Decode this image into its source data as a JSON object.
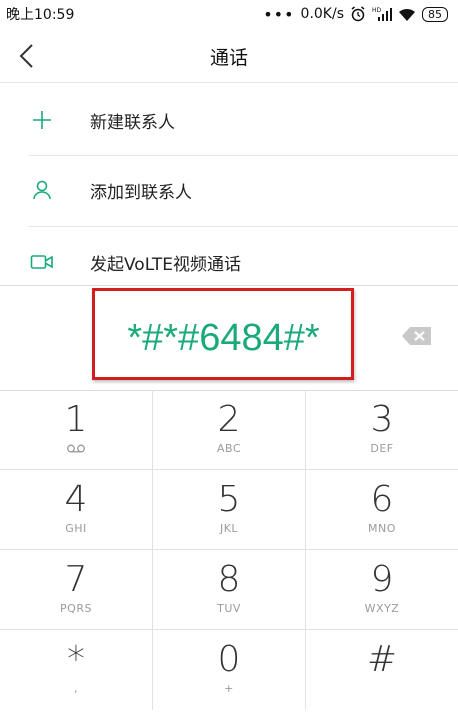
{
  "status_bar": {
    "time": "晚上10:59",
    "dots": "•••",
    "network_speed": "0.0K/s",
    "battery": "85"
  },
  "header": {
    "title": "通话"
  },
  "actions": [
    {
      "label": "新建联系人",
      "icon": "plus-icon"
    },
    {
      "label": "添加到联系人",
      "icon": "person-icon"
    },
    {
      "label": "发起VoLTE视频通话",
      "icon": "video-camera-icon"
    }
  ],
  "dialed_number": "*#*#6484#*",
  "keypad": [
    {
      "digit": "1",
      "letters": ""
    },
    {
      "digit": "2",
      "letters": "ABC"
    },
    {
      "digit": "3",
      "letters": "DEF"
    },
    {
      "digit": "4",
      "letters": "GHI"
    },
    {
      "digit": "5",
      "letters": "JKL"
    },
    {
      "digit": "6",
      "letters": "MNO"
    },
    {
      "digit": "7",
      "letters": "PQRS"
    },
    {
      "digit": "8",
      "letters": "TUV"
    },
    {
      "digit": "9",
      "letters": "WXYZ"
    },
    {
      "digit": "*",
      "letters": ","
    },
    {
      "digit": "0",
      "letters": "+"
    },
    {
      "digit": "#",
      "letters": ""
    }
  ],
  "colors": {
    "accent": "#1aaa77",
    "highlight": "#d21e1e"
  }
}
